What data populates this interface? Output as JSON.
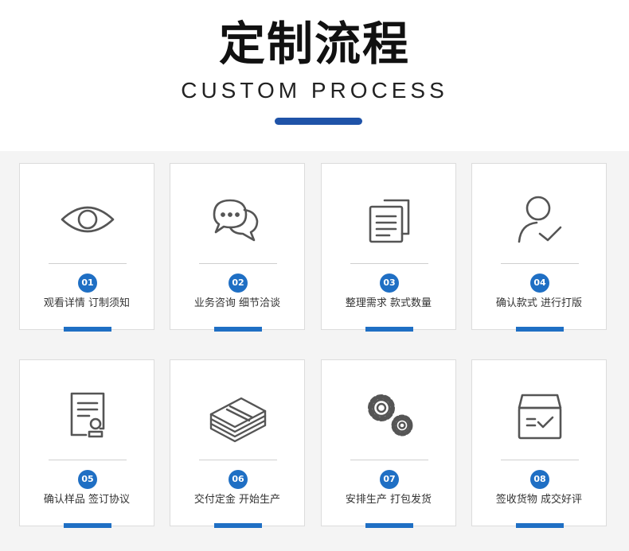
{
  "header": {
    "title_cn": "定制流程",
    "title_en": "CUSTOM PROCESS"
  },
  "colors": {
    "accent": "#1f6fc4",
    "title_bar": "#1f53a8",
    "panel_bg": "#f4f4f4",
    "icon_stroke": "#555555"
  },
  "steps": [
    {
      "number": "01",
      "label": "观看详情 订制须知",
      "icon": "eye-icon"
    },
    {
      "number": "02",
      "label": "业务咨询 细节洽谈",
      "icon": "chat-bubbles-icon"
    },
    {
      "number": "03",
      "label": "整理需求 款式数量",
      "icon": "documents-icon"
    },
    {
      "number": "04",
      "label": "确认款式 进行打版",
      "icon": "user-check-icon"
    },
    {
      "number": "05",
      "label": "确认样品 签订协议",
      "icon": "certificate-icon"
    },
    {
      "number": "06",
      "label": "交付定金 开始生产",
      "icon": "money-stack-icon"
    },
    {
      "number": "07",
      "label": "安排生产 打包发货",
      "icon": "gears-icon"
    },
    {
      "number": "08",
      "label": "签收货物 成交好评",
      "icon": "box-check-icon"
    }
  ]
}
